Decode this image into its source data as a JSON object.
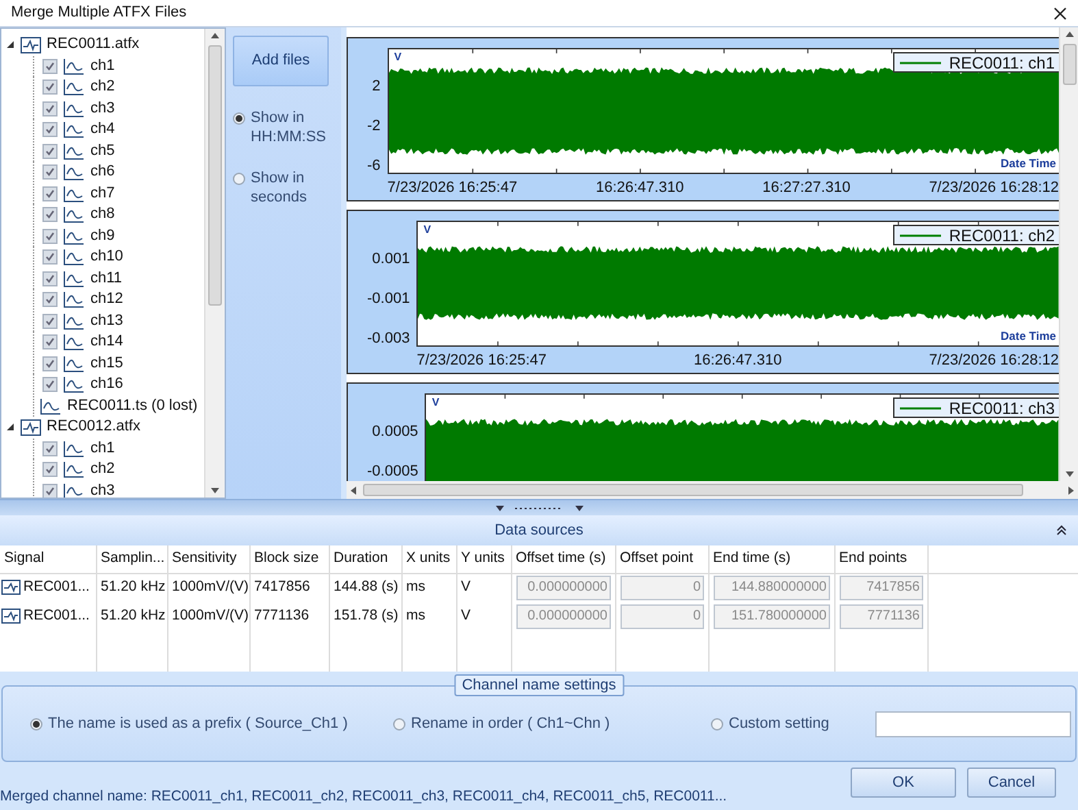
{
  "window": {
    "title": "Merge Multiple ATFX Files"
  },
  "file_tree": [
    {
      "name": "REC0011.atfx",
      "expanded": true,
      "children": [
        {
          "kind": "channel",
          "label": "ch1",
          "checked": true
        },
        {
          "kind": "channel",
          "label": "ch2",
          "checked": true
        },
        {
          "kind": "channel",
          "label": "ch3",
          "checked": true
        },
        {
          "kind": "channel",
          "label": "ch4",
          "checked": true
        },
        {
          "kind": "channel",
          "label": "ch5",
          "checked": true
        },
        {
          "kind": "channel",
          "label": "ch6",
          "checked": true
        },
        {
          "kind": "channel",
          "label": "ch7",
          "checked": true
        },
        {
          "kind": "channel",
          "label": "ch8",
          "checked": true
        },
        {
          "kind": "channel",
          "label": "ch9",
          "checked": true
        },
        {
          "kind": "channel",
          "label": "ch10",
          "checked": true
        },
        {
          "kind": "channel",
          "label": "ch11",
          "checked": true
        },
        {
          "kind": "channel",
          "label": "ch12",
          "checked": true
        },
        {
          "kind": "channel",
          "label": "ch13",
          "checked": true
        },
        {
          "kind": "channel",
          "label": "ch14",
          "checked": true
        },
        {
          "kind": "channel",
          "label": "ch15",
          "checked": true
        },
        {
          "kind": "channel",
          "label": "ch16",
          "checked": true
        },
        {
          "kind": "timestamp",
          "label": "REC0011.ts (0 lost)"
        }
      ]
    },
    {
      "name": "REC0012.atfx",
      "expanded": true,
      "children": [
        {
          "kind": "channel",
          "label": "ch1",
          "checked": true
        },
        {
          "kind": "channel",
          "label": "ch2",
          "checked": true
        },
        {
          "kind": "channel",
          "label": "ch3",
          "checked": true
        }
      ]
    }
  ],
  "side_panel": {
    "add_button": "Add files",
    "time_format": [
      {
        "label": "Show in HH:MM:SS",
        "selected": true
      },
      {
        "label": "Show in seconds",
        "selected": false
      }
    ]
  },
  "charts": [
    {
      "unit": "V",
      "legend": "REC0011: ch1",
      "y_labels": [
        "2",
        "-2",
        "-6"
      ],
      "x_axis_title": "Date Time",
      "x_labels": [
        "7/23/2026 16:25:47",
        "16:26:47.310",
        "16:27:27.310",
        "7/23/2026 16:28:12"
      ]
    },
    {
      "unit": "V",
      "legend": "REC0011: ch2",
      "y_labels": [
        "0.001",
        "-0.001",
        "-0.003"
      ],
      "x_axis_title": "Date Time",
      "x_labels": [
        "7/23/2026 16:25:47",
        "16:26:47.310",
        "7/23/2026 16:28:12"
      ]
    },
    {
      "unit": "V",
      "legend": "REC0011: ch3",
      "y_labels": [
        "0.0005",
        "-0.0005"
      ]
    }
  ],
  "data_sources": {
    "title": "Data sources",
    "columns": [
      {
        "label": "Signal",
        "kind": "signal"
      },
      {
        "label": "Samplin...",
        "kind": "text"
      },
      {
        "label": "Sensitivity",
        "kind": "text"
      },
      {
        "label": "Block size",
        "kind": "text"
      },
      {
        "label": "Duration",
        "kind": "text"
      },
      {
        "label": "X units",
        "kind": "text"
      },
      {
        "label": "Y units",
        "kind": "text"
      },
      {
        "label": "Offset time (s)",
        "kind": "field"
      },
      {
        "label": "Offset point",
        "kind": "field"
      },
      {
        "label": "End time (s)",
        "kind": "field"
      },
      {
        "label": "End points",
        "kind": "field"
      }
    ],
    "rows": [
      {
        "cells": [
          "REC001...",
          "51.20 kHz",
          "1000mV/(V)",
          "7417856",
          "144.88 (s)",
          "ms",
          "V",
          "0.000000000",
          "0",
          "144.880000000",
          "7417856"
        ]
      },
      {
        "cells": [
          "REC001...",
          "51.20 kHz",
          "1000mV/(V)",
          "7771136",
          "151.78 (s)",
          "ms",
          "V",
          "0.000000000",
          "0",
          "151.780000000",
          "7771136"
        ]
      }
    ]
  },
  "channel_name_settings": {
    "title": "Channel name settings",
    "options": [
      {
        "label": "The name is used as a prefix ( Source_Ch1 )",
        "kind": "radio",
        "selected": true
      },
      {
        "label": "Rename in order ( Ch1~Chn )",
        "kind": "radio",
        "selected": false
      },
      {
        "label": "Custom setting",
        "kind": "custom",
        "selected": false
      }
    ]
  },
  "footer": {
    "merged_names": "Merged channel name: REC0011_ch1, REC0011_ch2, REC0011_ch3, REC0011_ch4, REC0011_ch5, REC0011...",
    "buttons": [
      "OK",
      "Cancel"
    ]
  }
}
